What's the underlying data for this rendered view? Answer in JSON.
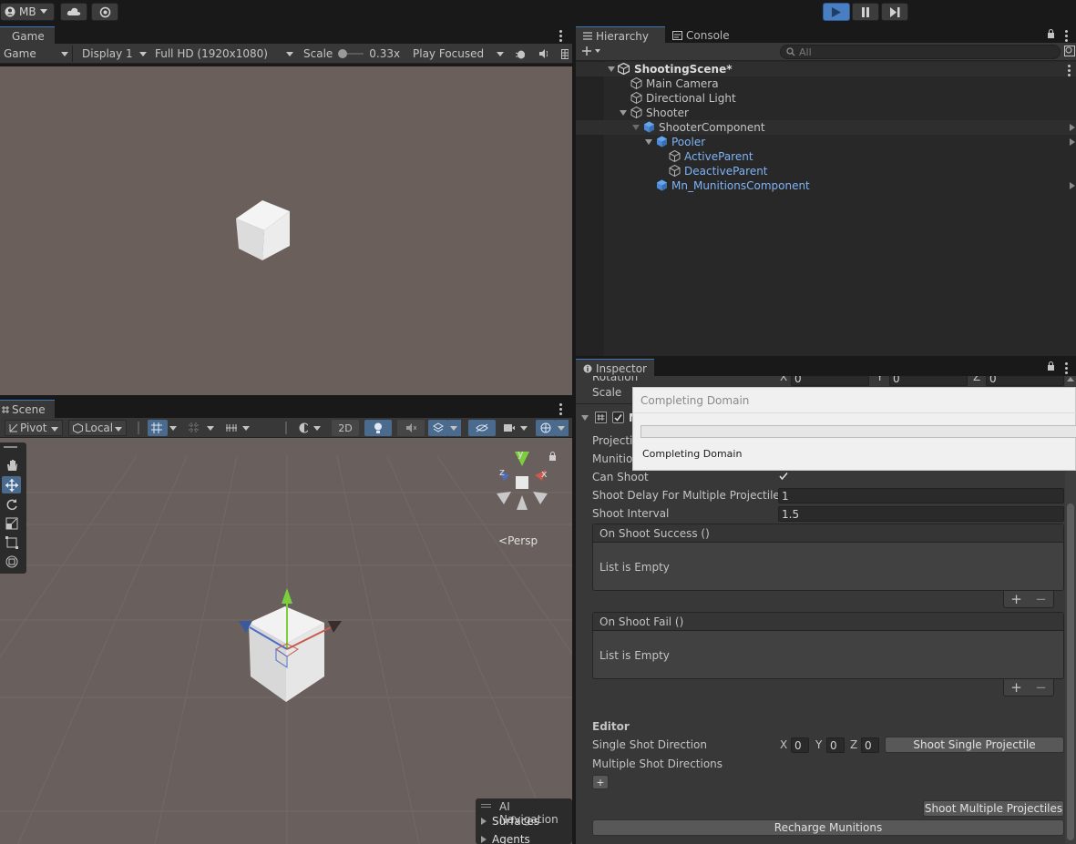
{
  "toolbar": {
    "account_label": "MB",
    "play_controls": [
      "play",
      "pause",
      "step"
    ]
  },
  "game_panel": {
    "tab_label": "Game",
    "mode_value": "Game",
    "display_value": "Display 1",
    "resolution_value": "Full HD (1920x1080)",
    "scale_label": "Scale",
    "scale_value": "0.33x",
    "play_mode_value": "Play Focused"
  },
  "scene_panel": {
    "tab_label": "Scene",
    "pivot_label": "Pivot",
    "space_label": "Local",
    "mode_2d_label": "2D",
    "gizmo_axes": {
      "y": "y",
      "x": "x",
      "z": "z"
    },
    "projection_label": "Persp",
    "overlay": {
      "title": "AI Navigation",
      "items": [
        "Surfaces",
        "Agents"
      ]
    }
  },
  "hierarchy": {
    "tab_label": "Hierarchy",
    "console_tab_label": "Console",
    "search_placeholder": "All",
    "scene_name": "ShootingScene*",
    "items": [
      {
        "label": "Main Camera",
        "prefab": false
      },
      {
        "label": "Directional Light",
        "prefab": false
      },
      {
        "label": "Shooter",
        "prefab": false
      },
      {
        "label": "ShooterComponent",
        "prefab": true
      },
      {
        "label": "Pooler",
        "prefab": true
      },
      {
        "label": "ActiveParent",
        "prefab": true
      },
      {
        "label": "DeactiveParent",
        "prefab": true
      },
      {
        "label": "Mn_MunitionsComponent",
        "prefab": true
      }
    ]
  },
  "inspector": {
    "tab_label": "Inspector",
    "rotation_label": "Rotation",
    "rotation": {
      "x_label": "X",
      "x": "0",
      "y_label": "Y",
      "y": "0",
      "z_label": "Z",
      "z": "0"
    },
    "scale_label": "Scale",
    "component_initial": "M",
    "projectile_label": "Projectile",
    "munitions_label": "Munitio",
    "can_shoot_label": "Can Shoot",
    "can_shoot_value": true,
    "shoot_delay_label": "Shoot Delay For Multiple Projectiles",
    "shoot_delay_value": "1",
    "shoot_interval_label": "Shoot Interval",
    "shoot_interval_value": "1.5",
    "on_shoot_success_label": "On Shoot Success ()",
    "on_shoot_success_empty": "List is Empty",
    "on_shoot_fail_label": "On Shoot Fail ()",
    "on_shoot_fail_empty": "List is Empty",
    "editor_header": "Editor",
    "single_shot_label": "Single Shot Direction",
    "single_shot": {
      "x_label": "X",
      "x": "0",
      "y_label": "Y",
      "y": "0",
      "z_label": "Z",
      "z": "0"
    },
    "shoot_single_button": "Shoot Single Projectile",
    "multiple_shot_label": "Multiple Shot Directions",
    "add_label": "+",
    "shoot_multiple_button": "Shoot Multiple Projectiles",
    "recharge_button": "Recharge Munitions",
    "plus_symbol": "+",
    "minus_symbol": "−"
  },
  "dialog": {
    "title": "Completing Domain",
    "message": "Completing Domain",
    "progress": 0
  },
  "colors": {
    "accent": "#3a79bb",
    "prefab_text": "#7fb3f5",
    "game_bg": "#6b5f5c",
    "scene_bg": "#695f5d",
    "panel_bg": "#383838"
  }
}
